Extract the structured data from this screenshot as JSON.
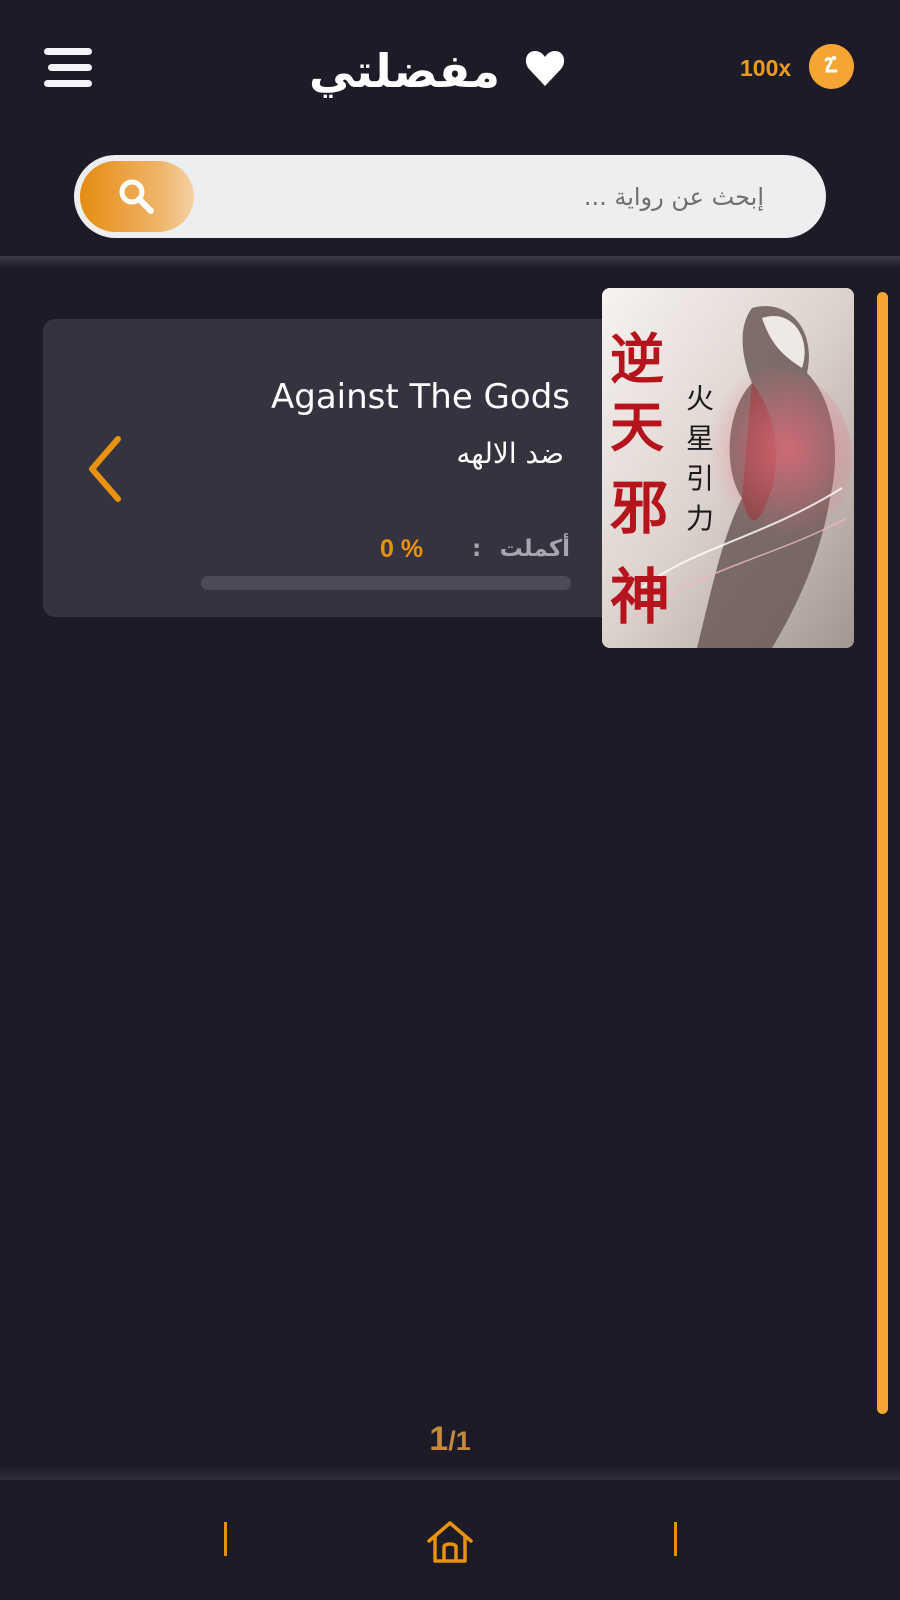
{
  "header": {
    "title": "مفضلتي",
    "coin_count": "100x",
    "menu_icon": "hamburger-menu-icon",
    "heart_icon": "heart-icon",
    "coin_icon": "coin-icon"
  },
  "search": {
    "placeholder": "إبحث عن رواية ...",
    "value": "",
    "button_icon": "search-icon"
  },
  "favorites": [
    {
      "title": "Against The Gods",
      "subtitle": "ضد الالهه",
      "progress_label": "أكملت",
      "progress_separator": ":",
      "progress_value_text": "0 %",
      "progress_fraction": 0,
      "cover_title_glyphs": "逆天邪神",
      "cover_author_glyphs": "火星引力"
    }
  ],
  "pagination": {
    "current": "1",
    "separator": "/",
    "total": "1"
  },
  "bottom_nav": {
    "home_icon": "home-icon"
  },
  "colors": {
    "background": "#1d1b27",
    "accent": "#e8920e",
    "card": "#34333f",
    "search_field": "#eceeef"
  }
}
